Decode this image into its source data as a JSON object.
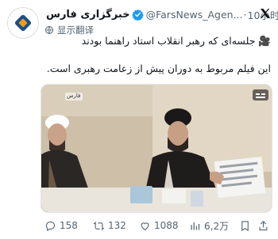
{
  "tweet": {
    "author_name": "خبرگزاری فارس",
    "handle": "@FarsNews_Agen...",
    "dot": "·",
    "time": "10小时",
    "translate": "显示翻译",
    "line1": "🎥 جلسه‌ای که رهبر انقلاب استاد راهنما بودند",
    "line2": "این فیلم مربوط به دوران پیش از زعامت رهبری است.",
    "video_logo_text": "فارس"
  },
  "actions": {
    "replies": "158",
    "retweets": "132",
    "likes": "1088",
    "views": "6,2万"
  },
  "colors": {
    "accent": "#1d9bf0",
    "muted": "#536471",
    "logo_orange": "#f39c12",
    "logo_blue": "#1d4e89"
  },
  "icons": [
    "fars-logo-icon",
    "verified-badge-icon",
    "x-logo-icon",
    "globe-icon",
    "reply-icon",
    "retweet-icon",
    "like-icon",
    "views-icon",
    "bookmark-icon",
    "share-icon",
    "captions-icon"
  ]
}
